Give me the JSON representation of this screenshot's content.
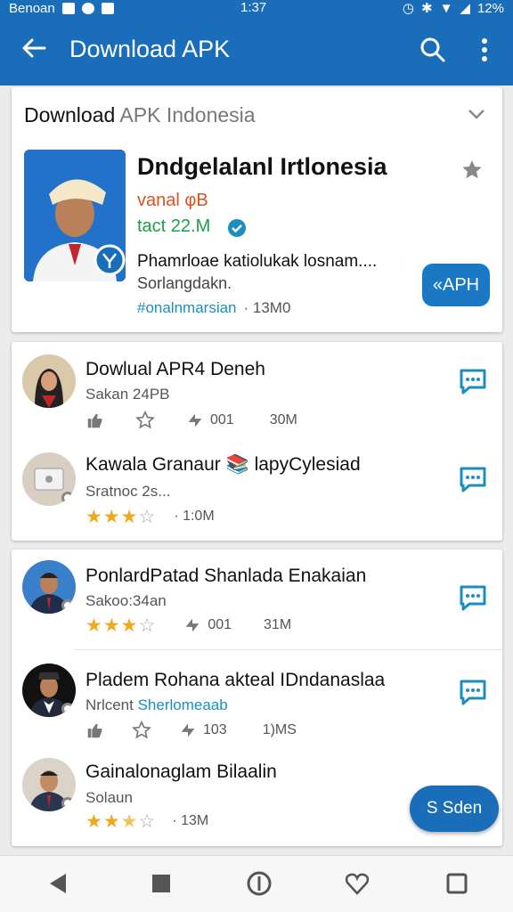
{
  "status": {
    "carrier": "Benoan",
    "time": "1:37",
    "battery": "12%"
  },
  "appbar": {
    "title": "Download APK"
  },
  "featured": {
    "heading_a": "Download",
    "heading_b": " APK Indonesia",
    "app_name": "Dndgelalanl Irtlonesia",
    "vendor": "vanal φB",
    "size": "tact 22.M",
    "description": "Phamrloae katiolukak losnam....",
    "subtitle": "Sorlangdakn.",
    "tags": "#onalnmarsian",
    "meta": "· 13M0",
    "button": "«APH"
  },
  "list1": [
    {
      "title": "Dowlual APR4 Deneh",
      "subtitle": "Sakan 24PB",
      "meta_type": "actions",
      "count1": "001",
      "count2": "30M"
    },
    {
      "title": "Kawala Granaur 📚 lapyCylesiad",
      "subtitle": "Sratnoc 2s...",
      "meta_type": "rating",
      "rating": 3,
      "count2": "· 1:0M"
    }
  ],
  "list2": [
    {
      "title": "PonlardPatad Shanlada Enakaian",
      "subtitle": "Sakoo:34an",
      "meta_type": "rating_actions",
      "rating": 3,
      "count1": "001",
      "count2": "31M"
    },
    {
      "title": "Pladem Rohana akteal IDndanaslaa",
      "subtitle_a": "Nrlcent",
      "subtitle_b": "Sherlomeaab",
      "meta_type": "actions",
      "count1": "103",
      "count2": "1)MS"
    },
    {
      "title": "Gainalonaglam Bilaalin",
      "subtitle": "Solaun",
      "meta_type": "rating",
      "rating": 2.5,
      "count2": "· 13M"
    }
  ],
  "fab": {
    "label": "S Sden"
  },
  "colors": {
    "primary": "#1a6db8",
    "star": "#f0a81c",
    "tag": "#1a8fbf",
    "size": "#1d9d4a",
    "vendor": "#d9531e"
  }
}
